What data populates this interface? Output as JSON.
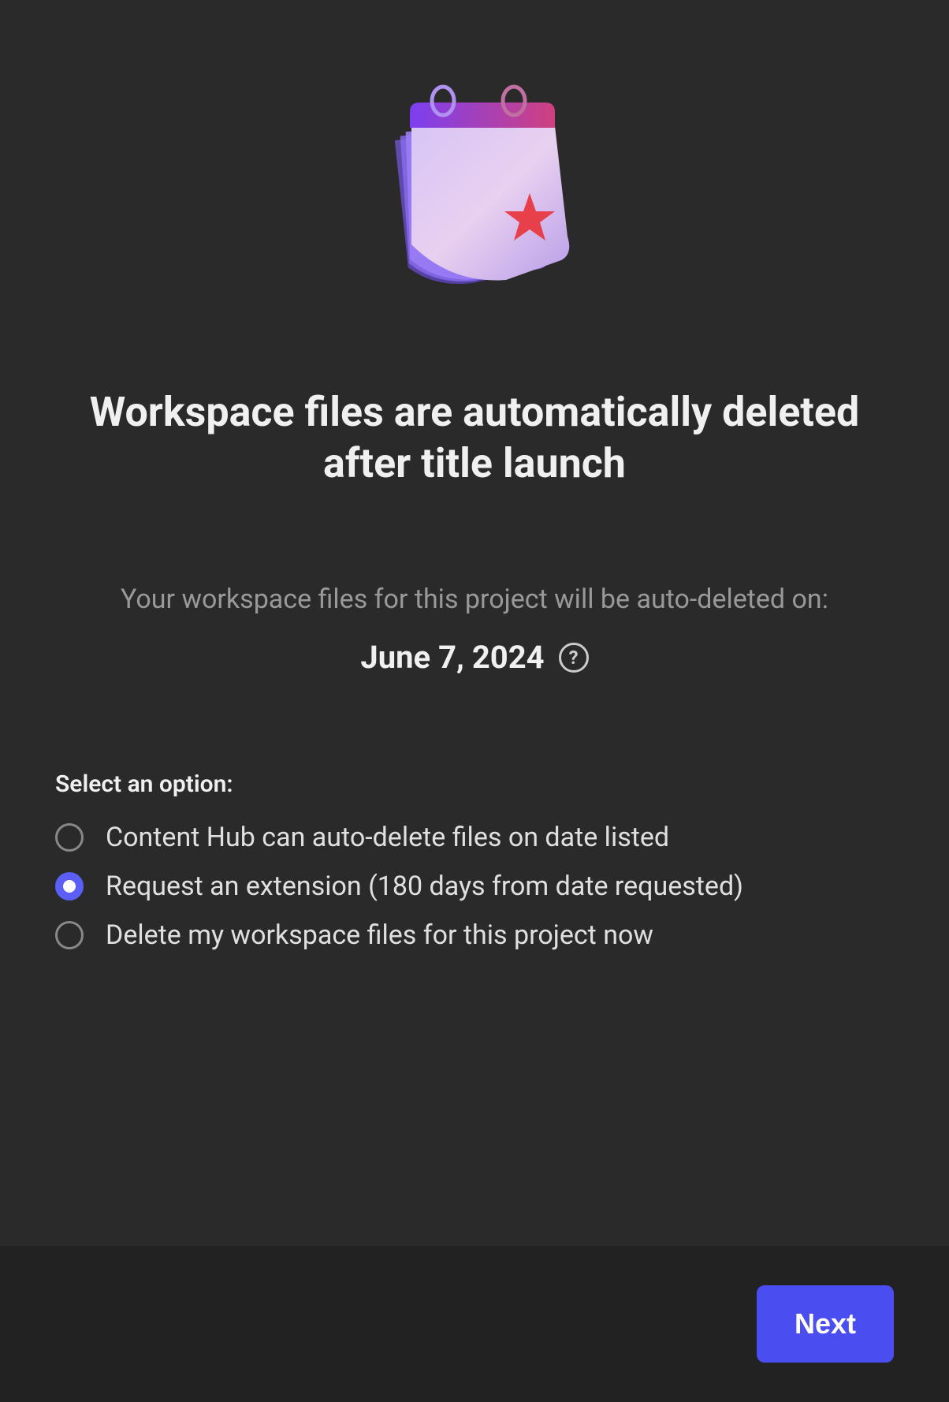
{
  "heading": "Workspace files are automatically deleted after title launch",
  "subtext": "Your workspace files for this project will be auto-deleted on:",
  "deletion_date": "June 7, 2024",
  "options_label": "Select an option:",
  "options": [
    {
      "label": "Content Hub can auto-delete files on date listed",
      "selected": false
    },
    {
      "label": "Request an extension (180 days from date requested)",
      "selected": true
    },
    {
      "label": "Delete my workspace files for this project now",
      "selected": false
    }
  ],
  "next_button_label": "Next",
  "colors": {
    "accent": "#4a4df0",
    "radio_selected": "#5b5ff7",
    "background": "#2a2a2a",
    "footer_background": "#222"
  }
}
